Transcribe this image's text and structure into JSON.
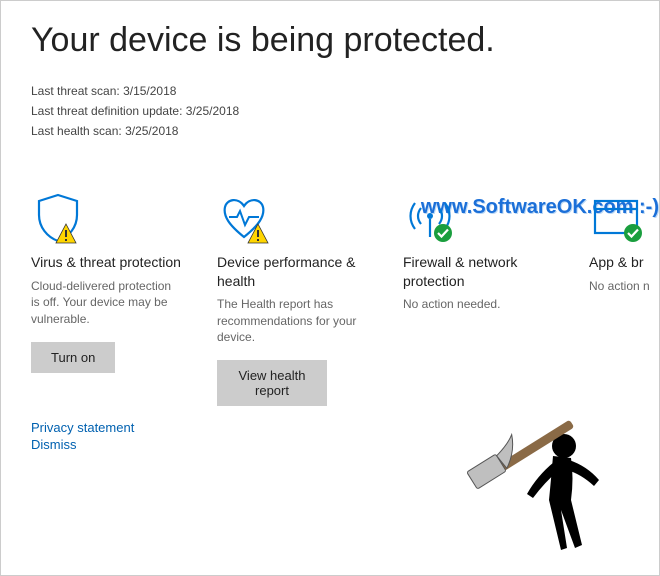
{
  "header": {
    "title": "Your device is being protected.",
    "last_threat_scan_label": "Last threat scan:",
    "last_threat_scan_value": "3/15/2018",
    "last_def_update_label": "Last threat definition update:",
    "last_def_update_value": "3/25/2018",
    "last_health_scan_label": "Last health scan:",
    "last_health_scan_value": "3/25/2018"
  },
  "watermark": "www.SoftwareOK.com :-)",
  "cards": {
    "virus": {
      "title": "Virus & threat protection",
      "desc": "Cloud-delivered protection is off. Your device may be vulnerable.",
      "button": "Turn on"
    },
    "device": {
      "title": "Device performance & health",
      "desc": "The Health report has recommendations for your device.",
      "button": "View health report"
    },
    "firewall": {
      "title": "Firewall & network protection",
      "desc": "No action needed."
    },
    "app": {
      "title": "App & br",
      "desc": "No action n"
    }
  },
  "links": {
    "privacy": "Privacy statement",
    "dismiss": "Dismiss"
  }
}
